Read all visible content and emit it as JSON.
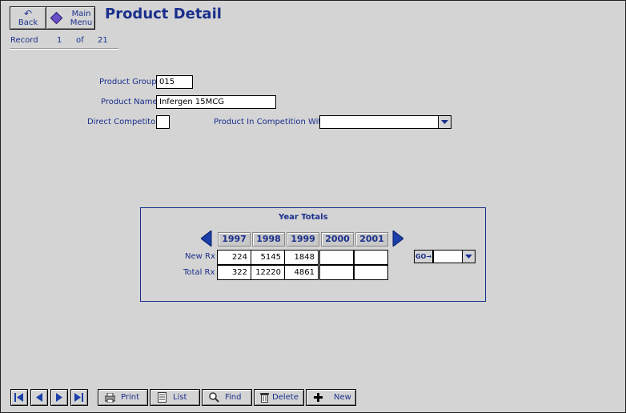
{
  "header": {
    "back_label": "Back",
    "main_menu_label_1": "Main",
    "main_menu_label_2": "Menu",
    "title": "Product Detail"
  },
  "record": {
    "label": "Record",
    "current": "1",
    "of_label": "of",
    "total": "21"
  },
  "form": {
    "product_group_label": "Product Group",
    "product_group_value": "015",
    "product_name_label": "Product Name",
    "product_name_value": "Infergen 15MCG",
    "direct_competitor_label": "Direct Competitor",
    "competition_label": "Product In Competition With",
    "competition_value": ""
  },
  "year_totals": {
    "title": "Year Totals",
    "years": [
      "1997",
      "1998",
      "1999",
      "2000",
      "2001"
    ],
    "rows": [
      {
        "label": "New Rx",
        "values": [
          "224",
          "5145",
          "1848",
          "",
          ""
        ]
      },
      {
        "label": "Total Rx",
        "values": [
          "322",
          "12220",
          "4861",
          "",
          ""
        ]
      }
    ],
    "go_label": "GO"
  },
  "toolbar": {
    "print_label": "Print",
    "list_label": "List",
    "find_label": "Find",
    "delete_label": "Delete",
    "new_label": "New"
  },
  "colors": {
    "text": "#1a2f8c",
    "background": "#d4d4d4"
  }
}
